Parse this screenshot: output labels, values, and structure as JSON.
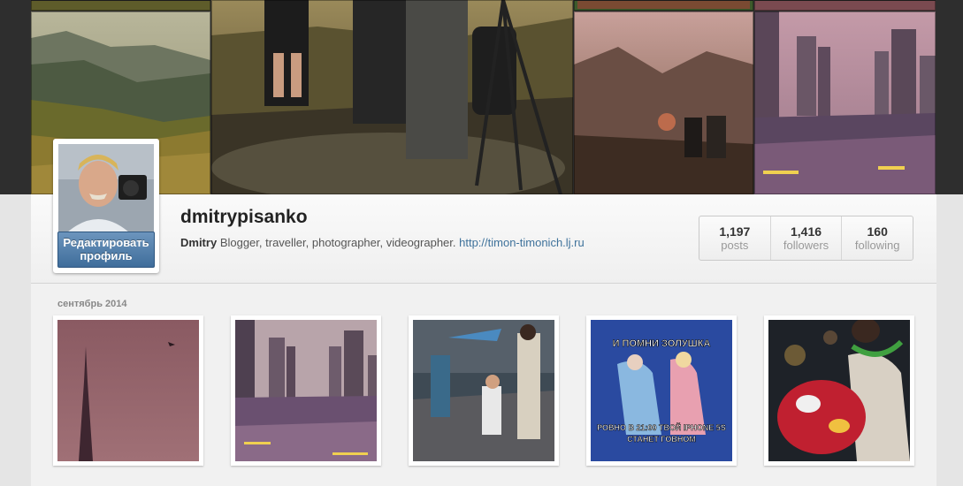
{
  "profile": {
    "username": "dmitrypisanko",
    "full_name": "Dmitry",
    "bio": "Blogger, traveller, photographer, videographer.",
    "website": "http://timon-timonich.lj.ru",
    "edit_label_line1": "Редактировать",
    "edit_label_line2": "профиль"
  },
  "stats": [
    {
      "value": "1,197",
      "label": "posts"
    },
    {
      "value": "1,416",
      "label": "followers"
    },
    {
      "value": "160",
      "label": "following"
    }
  ],
  "feed": {
    "month": "сентябрь 2014",
    "meme_text_top": "И ПОМНИ ЗОЛУШКА",
    "meme_text_bottom_1": "РОВНО В 21:00 ТВОЙ IPHONE 5S",
    "meme_text_bottom_2": "СТАНЕТ ГОВНОМ"
  },
  "colors": {
    "accent": "#3f729b",
    "button": "#4f7eaa"
  }
}
